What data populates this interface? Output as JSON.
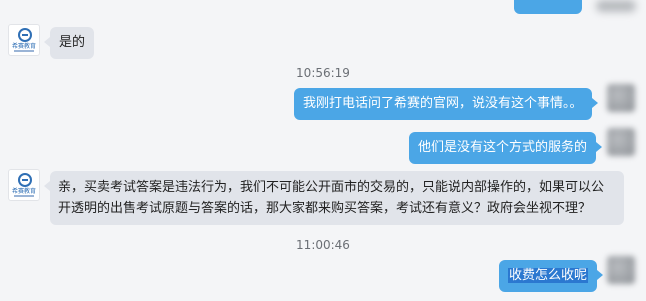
{
  "messages": [
    {
      "id": "m1",
      "side": "in",
      "text": "是的"
    },
    {
      "id": "m2",
      "side": "out",
      "text": "我刚打电话问了希赛的官网，说没有这个事情。。"
    },
    {
      "id": "m3",
      "side": "out",
      "text": "他们是没有这个方式的服务的"
    },
    {
      "id": "m4",
      "side": "in",
      "text": "亲，买卖考试答案是违法行为，我们不可能公开面市的交易的，只能说内部操作的，如果可以公开透明的出售考试原题与答案的话，那大家都来购买答案，考试还有意义？政府会坐视不理？"
    },
    {
      "id": "m5",
      "side": "out",
      "text": "收费怎么收呢"
    }
  ],
  "timestamps": [
    "10:56:19",
    "11:00:46"
  ],
  "agent_avatar": {
    "brand": "希赛教育"
  },
  "colors": {
    "outgoing": "#4ba6e6",
    "incoming": "#e1e4ea",
    "background": "#f4f5f7",
    "selection": "#2b78d0"
  },
  "icons": {
    "agent_avatar": "xisai-logo-icon",
    "user_avatar": "blurred-user-avatar-icon"
  }
}
